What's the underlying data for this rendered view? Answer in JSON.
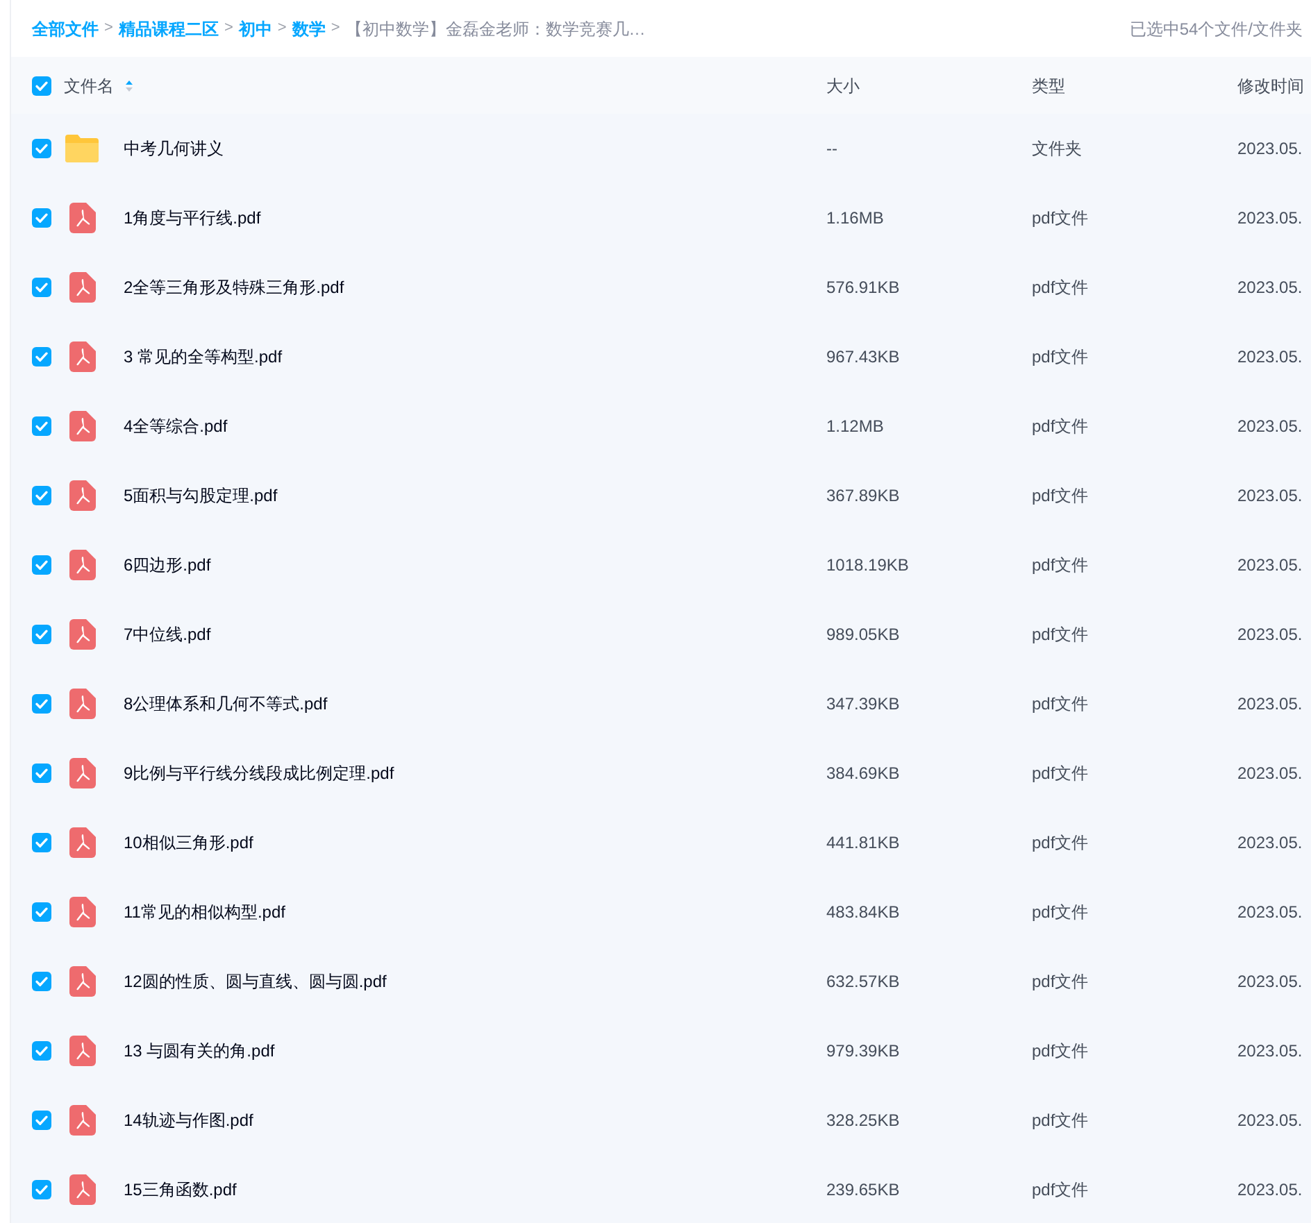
{
  "breadcrumb": {
    "items": [
      {
        "label": "全部文件"
      },
      {
        "label": "精品课程二区"
      },
      {
        "label": "初中"
      },
      {
        "label": "数学"
      }
    ],
    "current": "【初中数学】金磊金老师：数学竞赛几…",
    "separator": ">"
  },
  "selection_status": "已选中54个文件/文件夹",
  "table": {
    "select_all_checked": true,
    "columns": [
      {
        "label": "文件名",
        "sortable": true
      },
      {
        "label": "大小",
        "sortable": false
      },
      {
        "label": "类型",
        "sortable": false
      },
      {
        "label": "修改时间",
        "sortable": false
      }
    ],
    "rows": [
      {
        "kind": "folder",
        "name": "中考几何讲义",
        "size": "--",
        "type": "文件夹",
        "modified": "2023.05.",
        "checked": true
      },
      {
        "kind": "pdf",
        "name": "1角度与平行线.pdf",
        "size": "1.16MB",
        "type": "pdf文件",
        "modified": "2023.05.",
        "checked": true
      },
      {
        "kind": "pdf",
        "name": "2全等三角形及特殊三角形.pdf",
        "size": "576.91KB",
        "type": "pdf文件",
        "modified": "2023.05.",
        "checked": true
      },
      {
        "kind": "pdf",
        "name": "3 常见的全等构型.pdf",
        "size": "967.43KB",
        "type": "pdf文件",
        "modified": "2023.05.",
        "checked": true
      },
      {
        "kind": "pdf",
        "name": "4全等综合.pdf",
        "size": "1.12MB",
        "type": "pdf文件",
        "modified": "2023.05.",
        "checked": true
      },
      {
        "kind": "pdf",
        "name": "5面积与勾股定理.pdf",
        "size": "367.89KB",
        "type": "pdf文件",
        "modified": "2023.05.",
        "checked": true
      },
      {
        "kind": "pdf",
        "name": "6四边形.pdf",
        "size": "1018.19KB",
        "type": "pdf文件",
        "modified": "2023.05.",
        "checked": true
      },
      {
        "kind": "pdf",
        "name": "7中位线.pdf",
        "size": "989.05KB",
        "type": "pdf文件",
        "modified": "2023.05.",
        "checked": true
      },
      {
        "kind": "pdf",
        "name": "8公理体系和几何不等式.pdf",
        "size": "347.39KB",
        "type": "pdf文件",
        "modified": "2023.05.",
        "checked": true
      },
      {
        "kind": "pdf",
        "name": "9比例与平行线分线段成比例定理.pdf",
        "size": "384.69KB",
        "type": "pdf文件",
        "modified": "2023.05.",
        "checked": true
      },
      {
        "kind": "pdf",
        "name": "10相似三角形.pdf",
        "size": "441.81KB",
        "type": "pdf文件",
        "modified": "2023.05.",
        "checked": true
      },
      {
        "kind": "pdf",
        "name": "11常见的相似构型.pdf",
        "size": "483.84KB",
        "type": "pdf文件",
        "modified": "2023.05.",
        "checked": true
      },
      {
        "kind": "pdf",
        "name": "12圆的性质、圆与直线、圆与圆.pdf",
        "size": "632.57KB",
        "type": "pdf文件",
        "modified": "2023.05.",
        "checked": true
      },
      {
        "kind": "pdf",
        "name": "13 与圆有关的角.pdf",
        "size": "979.39KB",
        "type": "pdf文件",
        "modified": "2023.05.",
        "checked": true
      },
      {
        "kind": "pdf",
        "name": "14轨迹与作图.pdf",
        "size": "328.25KB",
        "type": "pdf文件",
        "modified": "2023.05.",
        "checked": true
      },
      {
        "kind": "pdf",
        "name": "15三角函数.pdf",
        "size": "239.65KB",
        "type": "pdf文件",
        "modified": "2023.05.",
        "checked": true
      }
    ]
  }
}
